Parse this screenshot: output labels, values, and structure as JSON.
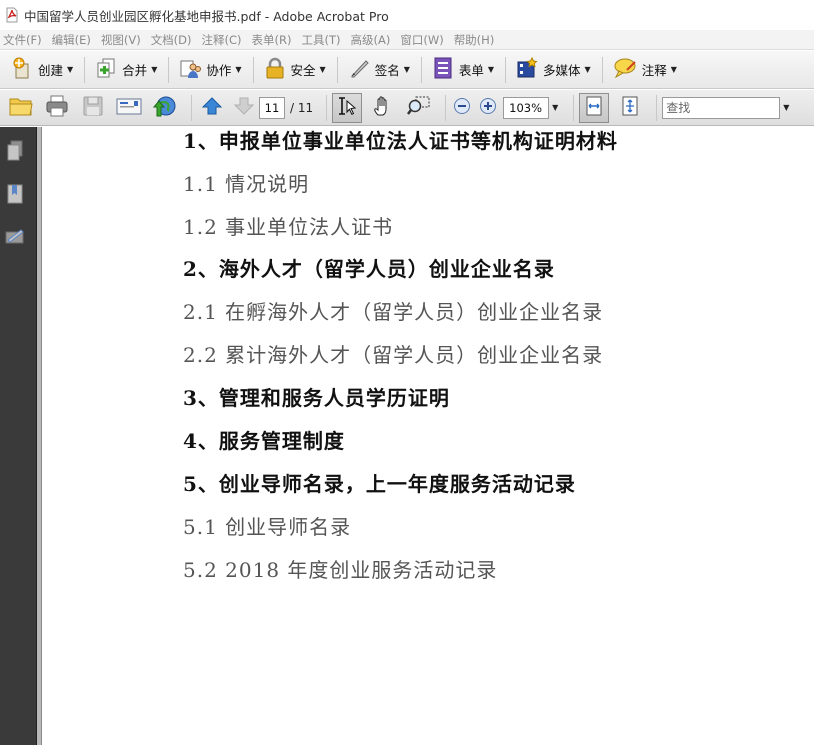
{
  "window": {
    "title": "中国留学人员创业园区孵化基地申报书.pdf - Adobe Acrobat Pro"
  },
  "menu": [
    "文件(F)",
    "编辑(E)",
    "视图(V)",
    "文档(D)",
    "注释(C)",
    "表单(R)",
    "工具(T)",
    "高级(A)",
    "窗口(W)",
    "帮助(H)"
  ],
  "toolbar": {
    "create": "创建",
    "combine": "合并",
    "collaborate": "协作",
    "secure": "安全",
    "sign": "签名",
    "forms": "表单",
    "multimedia": "多媒体",
    "comment": "注释"
  },
  "nav": {
    "page_current": "11",
    "page_total": "/ 11",
    "zoom": "103%",
    "search_placeholder": "查找"
  },
  "document": {
    "lines": [
      "1、申报单位事业单位法人证书等机构证明材料",
      "1.1 情况说明",
      "1.2 事业单位法人证书",
      "2、海外人才（留学人员）创业企业名录",
      "2.1 在孵海外人才（留学人员）创业企业名录",
      "2.2 累计海外人才（留学人员）创业企业名录",
      "3、管理和服务人员学历证明",
      "4、服务管理制度",
      "5、创业导师名录，上一年度服务活动记录",
      "5.1 创业导师名录",
      "5.2 2018 年度创业服务活动记录"
    ]
  },
  "colors": {
    "sidebar_bg": "#3a3a3a",
    "heading_text": "#111111",
    "subitem_text": "#555555"
  }
}
